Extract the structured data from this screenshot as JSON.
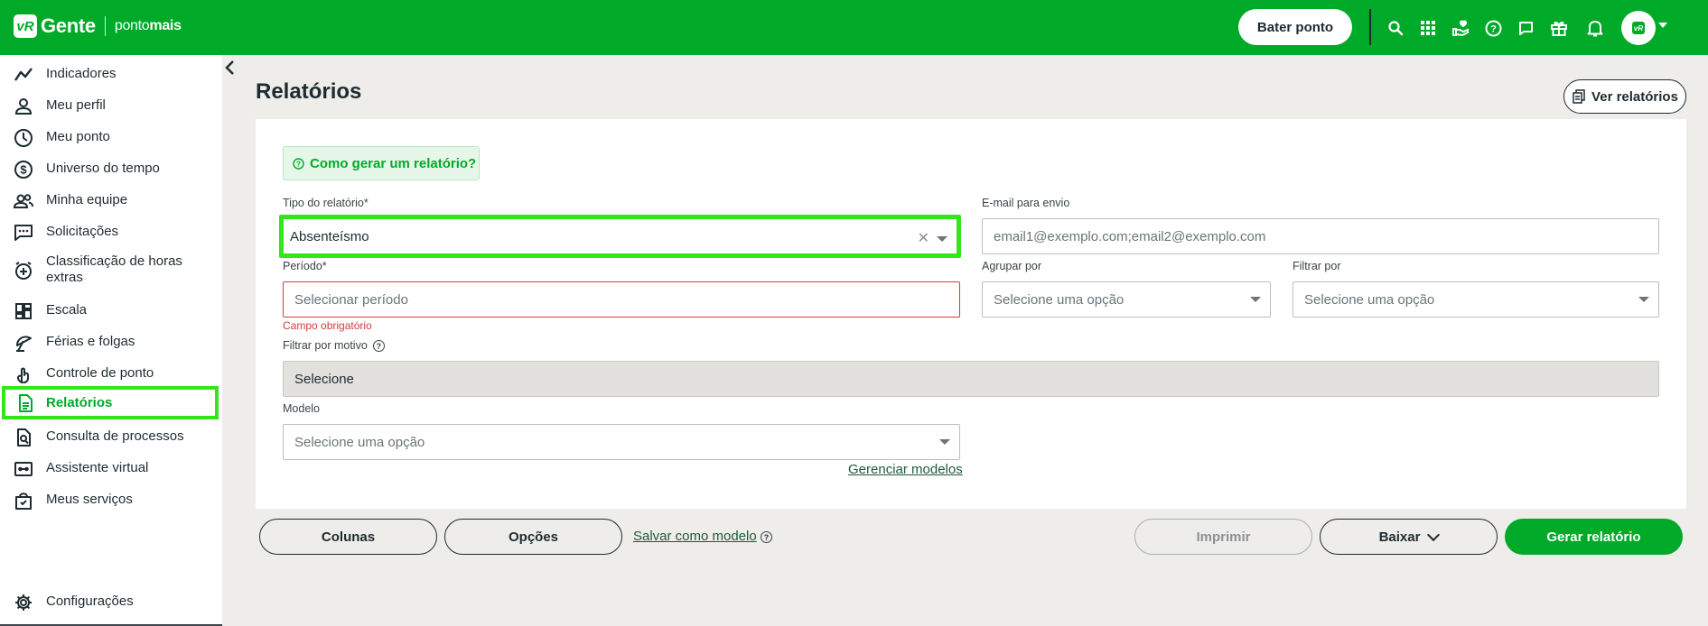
{
  "topbar": {
    "logo_badge": "vR",
    "logo_gente": "Gente",
    "logo_ponto": "ponto",
    "logo_mais": "mais",
    "bater_ponto": "Bater ponto",
    "icons": [
      "search-icon",
      "apps-grid-icon",
      "handshake-icon",
      "help-icon",
      "chat-icon",
      "gift-icon",
      "bell-icon"
    ],
    "avatar_text": "vR"
  },
  "sidebar": {
    "items": [
      {
        "label": "Indicadores",
        "icon": "trend-icon"
      },
      {
        "label": "Meu perfil",
        "icon": "user-icon"
      },
      {
        "label": "Meu ponto",
        "icon": "clock-icon"
      },
      {
        "label": "Universo do tempo",
        "icon": "dollar-circle-icon"
      },
      {
        "label": "Minha equipe",
        "icon": "team-icon"
      },
      {
        "label": "Solicitações",
        "icon": "message-icon"
      },
      {
        "label": "Classificação de horas extras",
        "icon": "clock-plus-icon"
      },
      {
        "label": "Escala",
        "icon": "dashboard-icon"
      },
      {
        "label": "Férias e folgas",
        "icon": "umbrella-icon"
      },
      {
        "label": "Controle de ponto",
        "icon": "fingerprint-icon"
      },
      {
        "label": "Relatórios",
        "icon": "document-icon"
      },
      {
        "label": "Consulta de processos",
        "icon": "doc-search-icon"
      },
      {
        "label": "Assistente virtual",
        "icon": "bot-icon"
      },
      {
        "label": "Meus serviços",
        "icon": "bag-icon"
      }
    ],
    "active_index": 10,
    "settings_label": "Configurações"
  },
  "main": {
    "title": "Relatórios",
    "ver_relatorios": "Ver relatórios",
    "how_to": "Como gerar um relatório?",
    "tipo_label": "Tipo do relatório*",
    "tipo_value": "Absenteísmo",
    "email_label": "E-mail para envio",
    "email_placeholder": "email1@exemplo.com;email2@exemplo.com",
    "periodo_label": "Período*",
    "periodo_placeholder": "Selecionar período",
    "periodo_error": "Campo obrigatório",
    "agrupar_label": "Agrupar por",
    "agrupar_placeholder": "Selecione uma opção",
    "filtrar_label": "Filtrar por",
    "filtrar_placeholder": "Selecione uma opção",
    "motivo_label": "Filtrar por motivo",
    "motivo_value": "Selecione",
    "modelo_label": "Modelo",
    "modelo_placeholder": "Selecione uma opção",
    "gerenciar_modelos": "Gerenciar modelos"
  },
  "actions": {
    "colunas": "Colunas",
    "opcoes": "Opções",
    "salvar_modelo": "Salvar como modelo",
    "imprimir": "Imprimir",
    "baixar": "Baixar",
    "gerar": "Gerar relatório"
  },
  "colors": {
    "brand": "#00aa29",
    "highlight": "#33e61a",
    "error": "#d73a3a"
  }
}
